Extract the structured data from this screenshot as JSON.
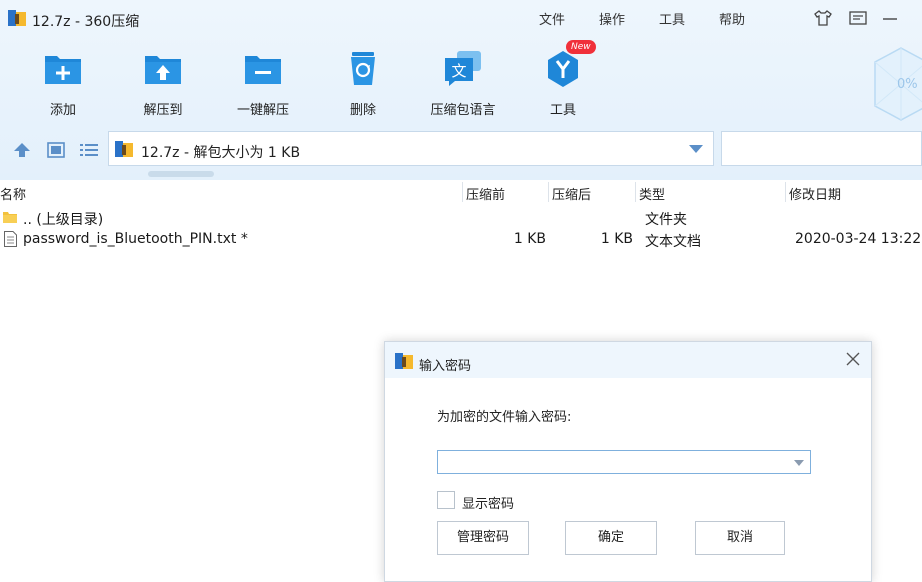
{
  "window": {
    "title": "12.7z - 360压缩",
    "menu": [
      "文件",
      "操作",
      "工具",
      "帮助"
    ]
  },
  "toolbar": {
    "items": [
      {
        "label": "添加",
        "icon": "add-folder-icon"
      },
      {
        "label": "解压到",
        "icon": "extract-to-icon"
      },
      {
        "label": "一键解压",
        "icon": "one-click-extract-icon"
      },
      {
        "label": "删除",
        "icon": "recycle-bin-icon"
      },
      {
        "label": "压缩包语言",
        "icon": "language-icon"
      },
      {
        "label": "工具",
        "icon": "tools-icon"
      }
    ],
    "new_badge": "New",
    "gem_percent": "0%"
  },
  "address": {
    "path": "12.7z - 解包大小为 1 KB"
  },
  "columns": {
    "name": "名称",
    "compressed_before": "压缩前",
    "compressed_after": "压缩后",
    "type": "类型",
    "modified": "修改日期"
  },
  "files": [
    {
      "name": ".. (上级目录)",
      "size_before": "",
      "size_after": "",
      "type": "文件夹",
      "modified": ""
    },
    {
      "name": "password_is_Bluetooth_PIN.txt *",
      "size_before": "1 KB",
      "size_after": "1 KB",
      "type": "文本文档",
      "modified": "2020-03-24 13:22"
    }
  ],
  "dialog": {
    "title": "输入密码",
    "prompt": "为加密的文件输入密码:",
    "password_value": "",
    "show_password_label": "显示密码",
    "manage_button": "管理密码",
    "ok_button": "确定",
    "cancel_button": "取消"
  },
  "colors": {
    "accent": "#1e88d8",
    "toolbar_bg": "#e6f2fc"
  }
}
